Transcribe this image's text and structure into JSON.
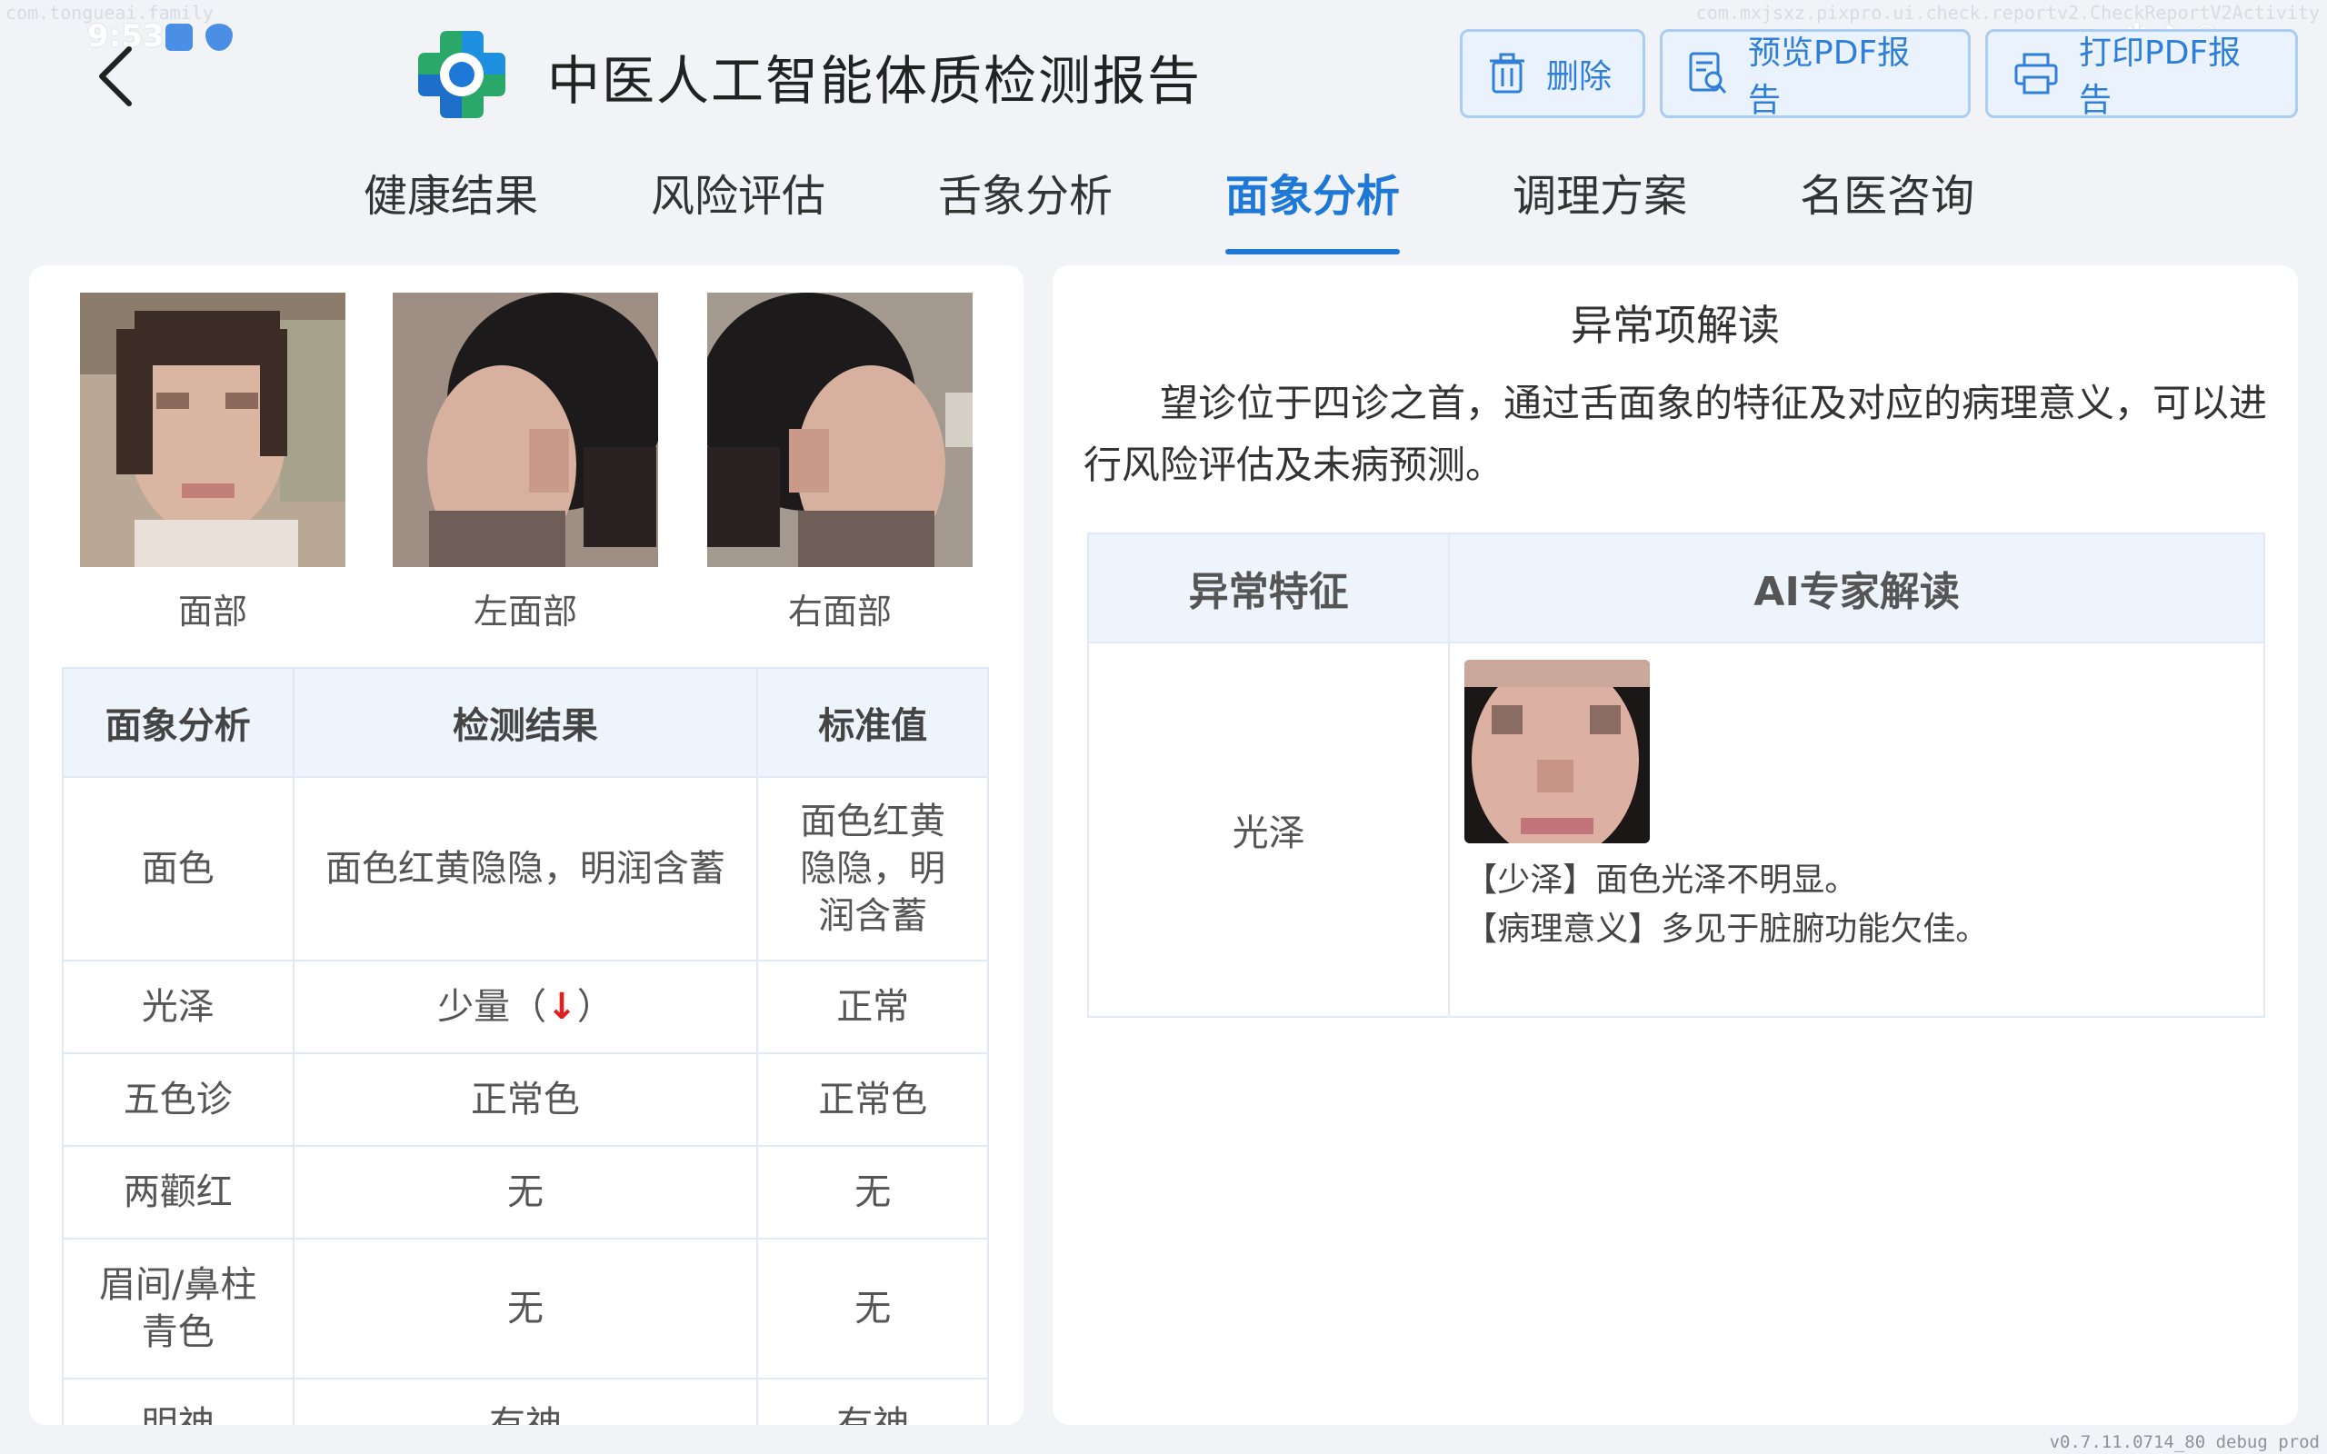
{
  "debug": {
    "package_left": "com.tongueai.family",
    "activity_right": "com.mxjsxz.pixpro.ui.check.reportv2.CheckReportV2Activity",
    "version": "v0.7.11.0714_80 debug prod"
  },
  "status_bar": {
    "time": "9:53",
    "right": "✱ ◗ ◒ ▭"
  },
  "header": {
    "title": "中医人工智能体质检测报告",
    "delete_label": "删除",
    "preview_label": "预览PDF报告",
    "print_label": "打印PDF报告"
  },
  "tabs": [
    {
      "label": "健康结果"
    },
    {
      "label": "风险评估"
    },
    {
      "label": "舌象分析"
    },
    {
      "label": "面象分析",
      "active": true
    },
    {
      "label": "调理方案"
    },
    {
      "label": "名医咨询"
    }
  ],
  "photos": [
    {
      "label": "面部"
    },
    {
      "label": "左面部"
    },
    {
      "label": "右面部"
    }
  ],
  "face_table": {
    "headers": [
      "面象分析",
      "检测结果",
      "标准值"
    ],
    "rows": [
      {
        "name": "面色",
        "result": "面色红黄隐隐，明润含蓄",
        "standard": "面色红黄隐隐，明润含蓄"
      },
      {
        "name": "光泽",
        "result": "少量（",
        "arrow": "↓",
        "result_suffix": "）",
        "standard": "正常"
      },
      {
        "name": "五色诊",
        "result": "正常色",
        "standard": "正常色"
      },
      {
        "name": "两颧红",
        "result": "无",
        "standard": "无"
      },
      {
        "name": "眉间/鼻柱青色",
        "result": "无",
        "standard": "无"
      },
      {
        "name": "明神",
        "result": "有神",
        "standard": "有神"
      }
    ]
  },
  "interpretation": {
    "title": "异常项解读",
    "intro": "望诊位于四诊之首，通过舌面象的特征及对应的病理意义，可以进行风险评估及未病预测。",
    "headers": [
      "异常特征",
      "AI专家解读"
    ],
    "rows": [
      {
        "feature": "光泽",
        "line1": "【少泽】面色光泽不明显。",
        "line2": "【病理意义】多见于脏腑功能欠佳。"
      }
    ]
  },
  "colors": {
    "accent": "#1e78d7",
    "button_border": "#a9cdf3",
    "arrow_red": "#e02020"
  }
}
